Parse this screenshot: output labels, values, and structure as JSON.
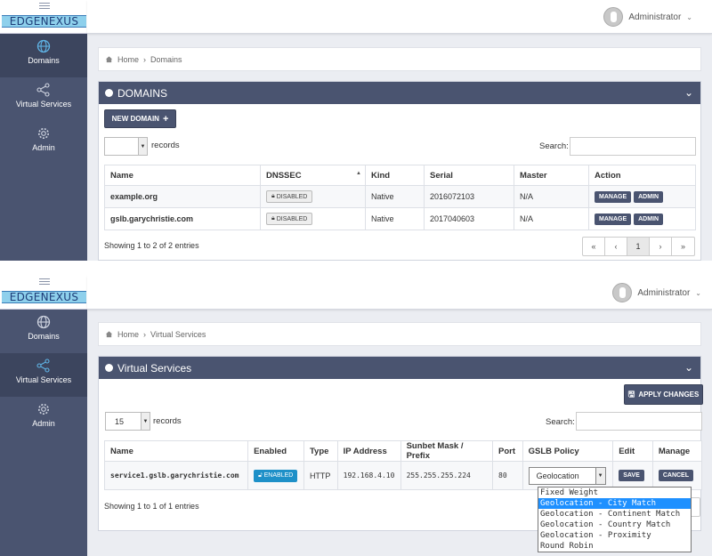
{
  "logo": "EDGENEXUS",
  "user": {
    "name": "Administrator"
  },
  "nav": [
    {
      "label": "Domains",
      "icon": "globe-icon"
    },
    {
      "label": "Virtual Services",
      "icon": "share-icon"
    },
    {
      "label": "Admin",
      "icon": "gear-icon"
    }
  ],
  "domains_view": {
    "breadcrumb": {
      "home": "Home",
      "current": "Domains"
    },
    "title": "DOMAINS",
    "new_button": "NEW DOMAIN",
    "records_value": "",
    "records_label": "records",
    "search_label": "Search:",
    "columns": [
      "Name",
      "DNSSEC",
      "Kind",
      "Serial",
      "Master",
      "Action"
    ],
    "rows": [
      {
        "name": "example.org",
        "dnssec": "DISABLED",
        "kind": "Native",
        "serial": "2016072103",
        "master": "N/A"
      },
      {
        "name": "gslb.garychristie.com",
        "dnssec": "DISABLED",
        "kind": "Native",
        "serial": "2017040603",
        "master": "N/A"
      }
    ],
    "manage_label": "MANAGE",
    "admin_label": "ADMIN",
    "showing": "Showing 1 to 2 of 2 entries",
    "pager": [
      "«",
      "‹",
      "1",
      "›",
      "»"
    ]
  },
  "vs_view": {
    "breadcrumb": {
      "home": "Home",
      "current": "Virtual Services"
    },
    "title": "Virtual Services",
    "apply_button": "APPLY CHANGES",
    "records_value": "15",
    "records_label": "records",
    "search_label": "Search:",
    "columns": [
      "Name",
      "Enabled",
      "Type",
      "IP Address",
      "Sunbet Mask / Prefix",
      "Port",
      "GSLB Policy",
      "Edit",
      "Manage"
    ],
    "row": {
      "name": "service1.gslb.garychristie.com",
      "enabled": "ENABLED",
      "type": "HTTP",
      "ip": "192.168.4.10",
      "mask": "255.255.255.224",
      "port": "80",
      "policy": "Geolocation",
      "save": "SAVE",
      "cancel": "CANCEL"
    },
    "showing": "Showing 1 to 1 of 1 entries",
    "policy_options": [
      "Fixed Weight",
      "Geolocation - City Match",
      "Geolocation - Continent Match",
      "Geolocation - Country Match",
      "Geolocation - Proximity",
      "Round Robin"
    ],
    "highlighted_option_index": 1
  }
}
